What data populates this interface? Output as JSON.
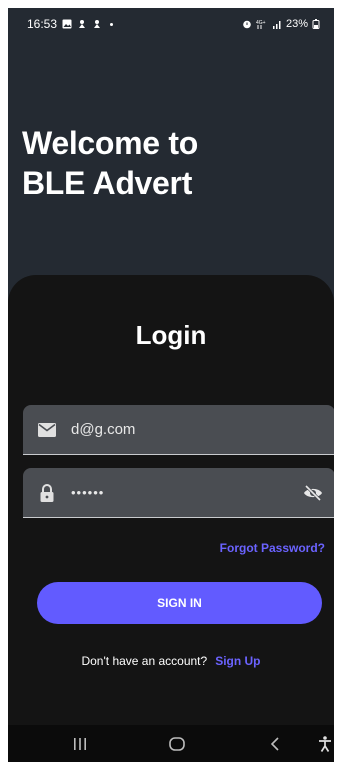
{
  "status_bar": {
    "time": "16:53",
    "battery": "23%"
  },
  "welcome": {
    "line1": "Welcome to",
    "line2": "BLE Advert"
  },
  "login": {
    "title": "Login",
    "email_value": "d@g.com",
    "password_value": "••••••",
    "forgot_label": "Forgot Password?",
    "signin_label": "SIGN IN",
    "no_account_text": "Don't have an account?",
    "signup_label": "Sign Up"
  },
  "colors": {
    "accent": "#625bff",
    "background_top": "#242a32",
    "sheet": "#141414",
    "field": "#4a4d52"
  },
  "icons": {
    "email": "mail-icon",
    "password": "lock-icon",
    "visibility": "eye-off-icon",
    "nav_recents": "recents-icon",
    "nav_home": "home-icon",
    "nav_back": "back-icon",
    "nav_accessibility": "accessibility-icon"
  }
}
